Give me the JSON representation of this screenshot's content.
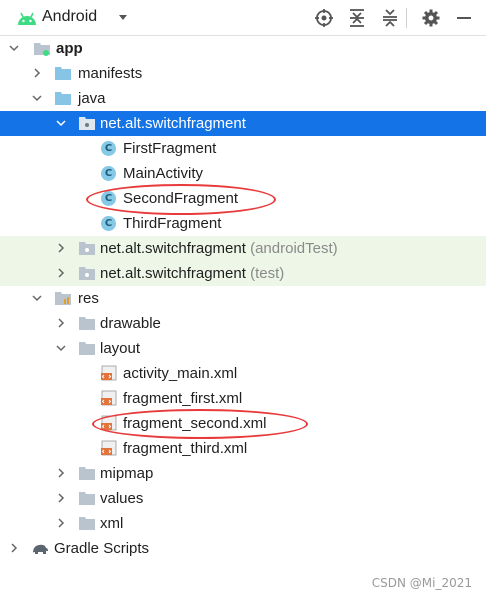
{
  "toolbar": {
    "view_label": "Android",
    "icons": [
      "locate-icon",
      "expand-all-icon",
      "collapse-all-icon",
      "settings-gear-icon",
      "minimize-icon"
    ]
  },
  "tree": {
    "app": "app",
    "manifests": "manifests",
    "java": "java",
    "pkg_main": "net.alt.switchfragment",
    "first_fragment": "FirstFragment",
    "main_activity": "MainActivity",
    "second_fragment": "SecondFragment",
    "third_fragment": "ThirdFragment",
    "pkg_android_test": "net.alt.switchfragment",
    "pkg_android_test_suffix": "(androidTest)",
    "pkg_test": "net.alt.switchfragment",
    "pkg_test_suffix": "(test)",
    "res": "res",
    "drawable": "drawable",
    "layout": "layout",
    "activity_main_xml": "activity_main.xml",
    "fragment_first_xml": "fragment_first.xml",
    "fragment_second_xml": "fragment_second.xml",
    "fragment_third_xml": "fragment_third.xml",
    "mipmap": "mipmap",
    "values": "values",
    "xml": "xml",
    "gradle_scripts": "Gradle Scripts"
  },
  "class_icon_letter": "C",
  "watermark": "CSDN @Mi_2021",
  "colors": {
    "selection": "#1473e6",
    "test_rows": "#eef6e8",
    "annotation": "#e83a3a"
  }
}
